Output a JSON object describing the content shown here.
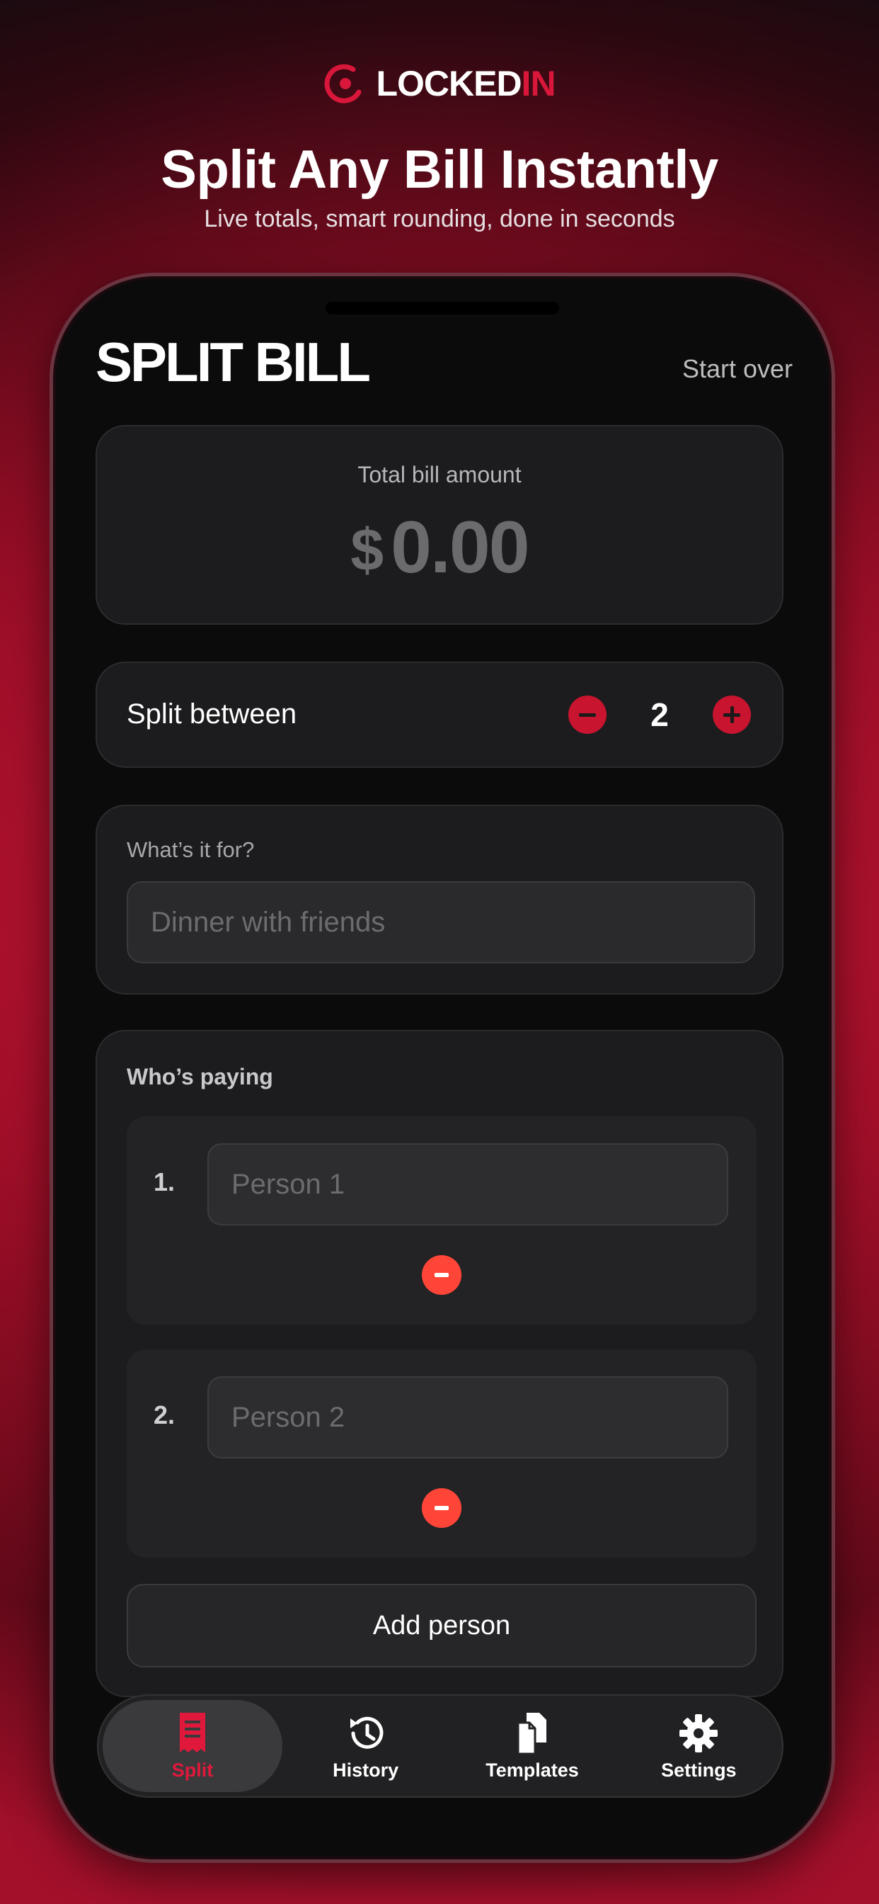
{
  "brand": {
    "name_prefix": "LOCKED",
    "name_accent": "IN"
  },
  "hero": {
    "title": "Split Any Bill Instantly",
    "subtitle": "Live totals, smart rounding, done in seconds"
  },
  "app": {
    "title": "SPLIT BILL",
    "start_over": "Start over",
    "total": {
      "label": "Total bill amount",
      "currency": "$",
      "amount": "0.00"
    },
    "split": {
      "label": "Split between",
      "count": "2"
    },
    "purpose": {
      "label": "What’s it for?",
      "placeholder": "Dinner with friends"
    },
    "payers": {
      "label": "Who’s paying",
      "people": [
        {
          "number": "1.",
          "placeholder": "Person 1"
        },
        {
          "number": "2.",
          "placeholder": "Person 2"
        }
      ],
      "add_label": "Add person"
    },
    "tabs": [
      {
        "label": "Split",
        "icon": "receipt-icon",
        "active": true
      },
      {
        "label": "History",
        "icon": "history-icon",
        "active": false
      },
      {
        "label": "Templates",
        "icon": "documents-icon",
        "active": false
      },
      {
        "label": "Settings",
        "icon": "gear-icon",
        "active": false
      }
    ]
  },
  "colors": {
    "accent": "#d8173a",
    "remove": "#ff4538",
    "card": "#1c1c1e"
  }
}
